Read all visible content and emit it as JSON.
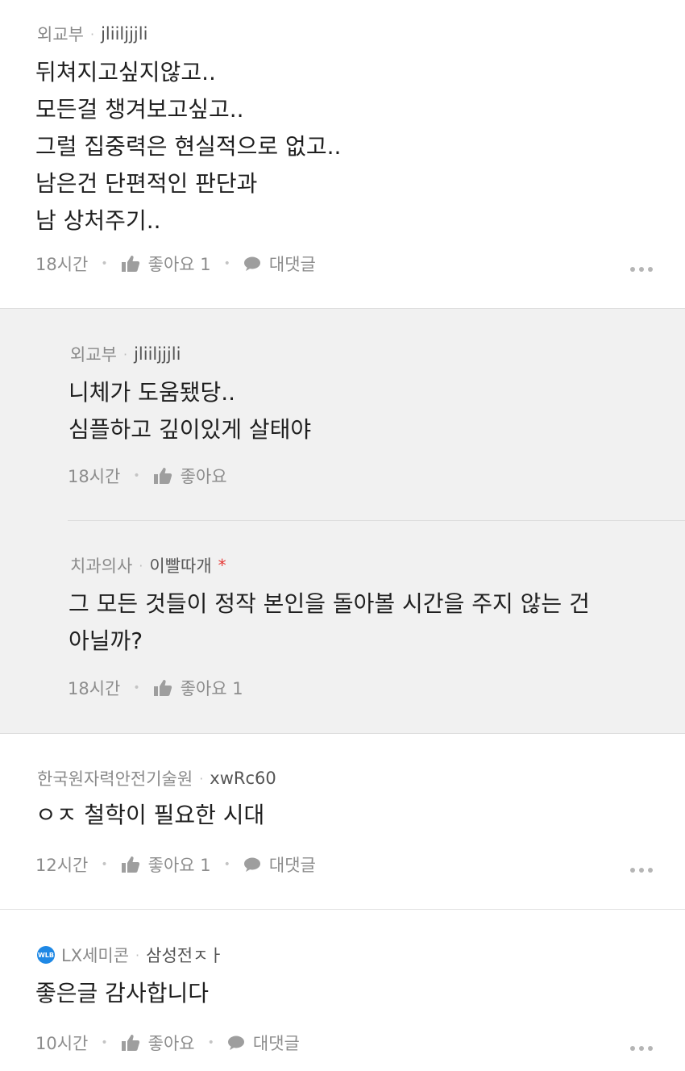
{
  "comments": [
    {
      "company": "외교부",
      "nickname": "jliiljjjli",
      "lines": [
        "뒤쳐지고싶지않고..",
        "모든걸 챙겨보고싶고..",
        "그럴 집중력은 현실적으로 없고..",
        "남은건 단편적인 판단과",
        "남 상처주기.."
      ],
      "time": "18시간",
      "like_label": "좋아요 1",
      "reply_label": "대댓글"
    },
    {
      "company": "외교부",
      "nickname": "jliiljjjli",
      "lines": [
        "니체가 도움됐당..",
        "심플하고 깊이있게 살태야"
      ],
      "time": "18시간",
      "like_label": "좋아요"
    },
    {
      "company": "치과의사",
      "nickname": "이빨따개",
      "star": "*",
      "lines": [
        "그 모든 것들이 정작 본인을 돌아볼 시간을 주지 않는 건",
        "아닐까?"
      ],
      "time": "18시간",
      "like_label": "좋아요 1"
    },
    {
      "company": "한국원자력안전기술원",
      "nickname": "xwRc60",
      "lines": [
        "ㅇㅈ 철학이 필요한 시대"
      ],
      "time": "12시간",
      "like_label": "좋아요 1",
      "reply_label": "대댓글"
    },
    {
      "company": "LX세미콘",
      "badge": "WLB",
      "nickname": "삼성전ㅈㅏ",
      "lines": [
        "좋은글 감사합니다"
      ],
      "time": "10시간",
      "like_label": "좋아요",
      "reply_label": "대댓글"
    }
  ],
  "icons": {
    "like": "thumbs-up-icon",
    "reply": "speech-bubble-icon",
    "more": "more-dots-icon"
  },
  "colors": {
    "reply_bg": "#f1f1f1",
    "star": "#e53935",
    "meta": "#8d8d8d"
  }
}
